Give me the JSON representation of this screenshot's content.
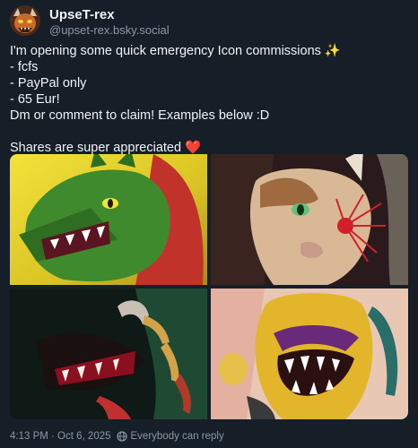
{
  "author": {
    "display_name": "UpseT-rex",
    "handle": "@upset-rex.bsky.social"
  },
  "post": {
    "lines": [
      "I'm opening some quick emergency Icon commissions ✨",
      "- fcfs",
      "- PayPal only",
      "- 65 Eur!",
      "Dm or comment to claim! Examples below :D",
      "",
      "Shares are super appreciated ❤️"
    ],
    "images": [
      {
        "name": "image-green-dragon",
        "accent": "#e2c21e"
      },
      {
        "name": "image-deer-red-flower",
        "accent": "#c81a2a"
      },
      {
        "name": "image-dark-claws-creature",
        "accent": "#1c5a3c"
      },
      {
        "name": "image-yellow-toothed-creature",
        "accent": "#d9a21f"
      }
    ]
  },
  "footer": {
    "timestamp": "4:13 PM · Oct 6, 2025",
    "reply_setting": "Everybody can reply"
  },
  "colors": {
    "background": "#161e27",
    "text": "#f1f3f5",
    "muted": "#8b98a5"
  }
}
